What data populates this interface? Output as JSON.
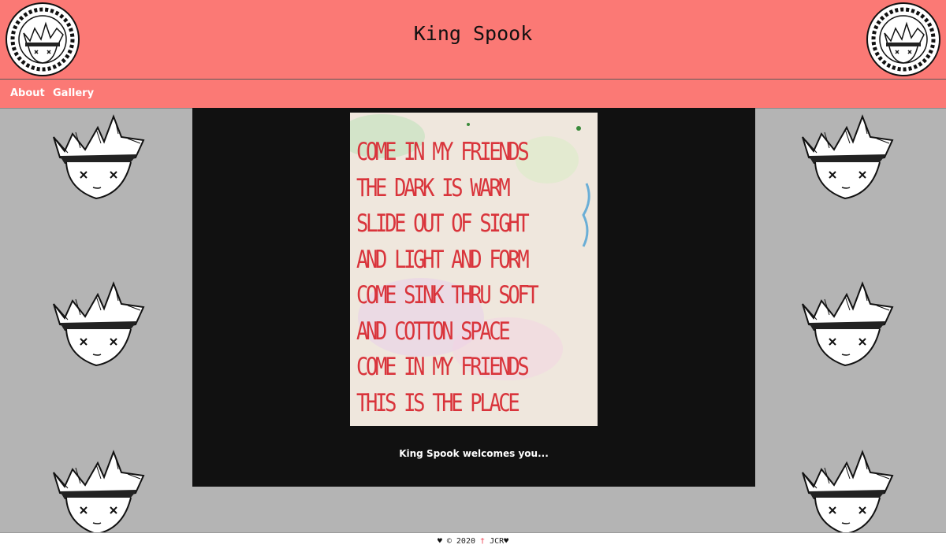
{
  "site": {
    "title": "King Spook"
  },
  "nav": {
    "items": [
      "About",
      "Gallery"
    ]
  },
  "art": {
    "lines": [
      "Come in my friends",
      "The dark is warm",
      "Slide out of sight",
      "And light and form",
      "Come sink thru soft",
      "And cotton space",
      "Come in my friends",
      "This is the place"
    ],
    "ink_color": "#d9343b"
  },
  "main": {
    "caption": "King Spook welcomes you..."
  },
  "footer": {
    "left": "♥",
    "year": "© 2020",
    "sep": "†",
    "author": "JCR",
    "right": "♥"
  },
  "colors": {
    "header": "#fb7975",
    "background": "#b4b4b4",
    "panel": "#111111"
  }
}
